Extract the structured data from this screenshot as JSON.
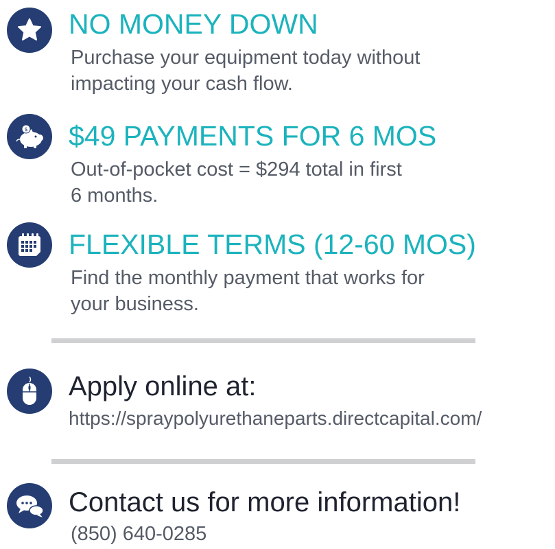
{
  "features": [
    {
      "title": "NO MONEY DOWN",
      "line1": "Purchase your equipment today without",
      "line2": "impacting your cash flow.",
      "icon": "star-icon"
    },
    {
      "title": "$49 PAYMENTS FOR 6 MOS",
      "line1": "Out-of-pocket cost = $294 total in first",
      "line2": "6 months.",
      "icon": "piggy-bank-icon"
    },
    {
      "title": "FLEXIBLE TERMS (12-60 MOS)",
      "line1": "Find the monthly payment that works for",
      "line2": "your business.",
      "icon": "calendar-icon"
    }
  ],
  "apply": {
    "title": "Apply online at:",
    "url": "https://spraypolyurethaneparts.directcapital.com/",
    "icon": "mouse-icon"
  },
  "contact": {
    "title": "Contact us for more information!",
    "phone": "(850) 640-0285",
    "icon": "chat-bubbles-icon"
  },
  "colors": {
    "icon_circle": "#253d72",
    "heading_teal": "#1bb3bd",
    "heading_dark": "#1f2330",
    "body_text": "#555b66",
    "divider": "#cfd0d2"
  }
}
